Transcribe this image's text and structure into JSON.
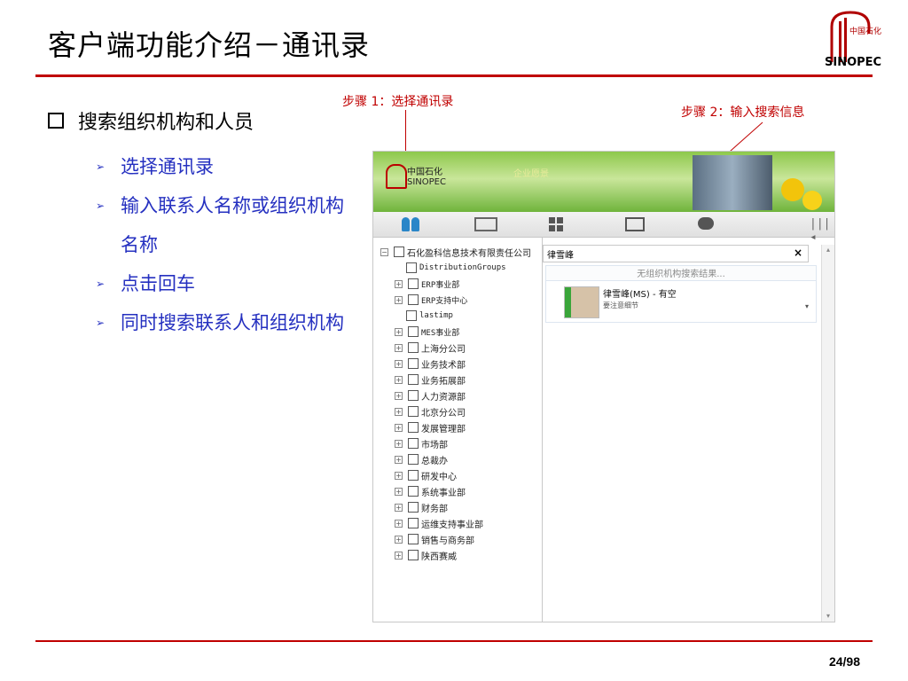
{
  "slide": {
    "title": "客户端功能介绍－通讯录",
    "page": "24/98",
    "logo_text": "中国石化 SINOPEC"
  },
  "bullets": {
    "main": "搜索组织机构和人员",
    "subs": [
      "选择通讯录",
      "输入联系人名称或组织机构名称",
      "点击回车",
      "同时搜索联系人和组织机构"
    ]
  },
  "annotations": {
    "step1": "步骤 1：选择通讯录",
    "step2": "步骤 2：输入搜索信息"
  },
  "app": {
    "banner": {
      "brand_cn": "中国石化",
      "brand_en": "SINOPEC",
      "motto": "企业愿景"
    },
    "toolbar_icons": [
      "contacts-icon",
      "note-icon",
      "apps-icon",
      "mail-icon",
      "chat-icon",
      "collapse-icon"
    ],
    "tree": {
      "root": "石化盈科信息技术有限责任公司",
      "items": [
        {
          "label": "DistributionGroups",
          "expandable": false
        },
        {
          "label": "ERP事业部",
          "expandable": true
        },
        {
          "label": "ERP支持中心",
          "expandable": true
        },
        {
          "label": "lastimp",
          "expandable": false
        },
        {
          "label": "MES事业部",
          "expandable": true
        },
        {
          "label": "上海分公司",
          "expandable": true
        },
        {
          "label": "业务技术部",
          "expandable": true
        },
        {
          "label": "业务拓展部",
          "expandable": true
        },
        {
          "label": "人力资源部",
          "expandable": true
        },
        {
          "label": "北京分公司",
          "expandable": true
        },
        {
          "label": "发展管理部",
          "expandable": true
        },
        {
          "label": "市场部",
          "expandable": true
        },
        {
          "label": "总裁办",
          "expandable": true
        },
        {
          "label": "研发中心",
          "expandable": true
        },
        {
          "label": "系统事业部",
          "expandable": true
        },
        {
          "label": "财务部",
          "expandable": true
        },
        {
          "label": "运维支持事业部",
          "expandable": true
        },
        {
          "label": "销售与商务部",
          "expandable": true
        },
        {
          "label": "陕西赛威",
          "expandable": true
        }
      ]
    },
    "search": {
      "value": "律雪峰",
      "clear": "×"
    },
    "no_result": "无组织机构搜索结果...",
    "result": {
      "name": "律雪峰(MS) - 有空",
      "status": "要注意细节",
      "more": "▾"
    }
  }
}
